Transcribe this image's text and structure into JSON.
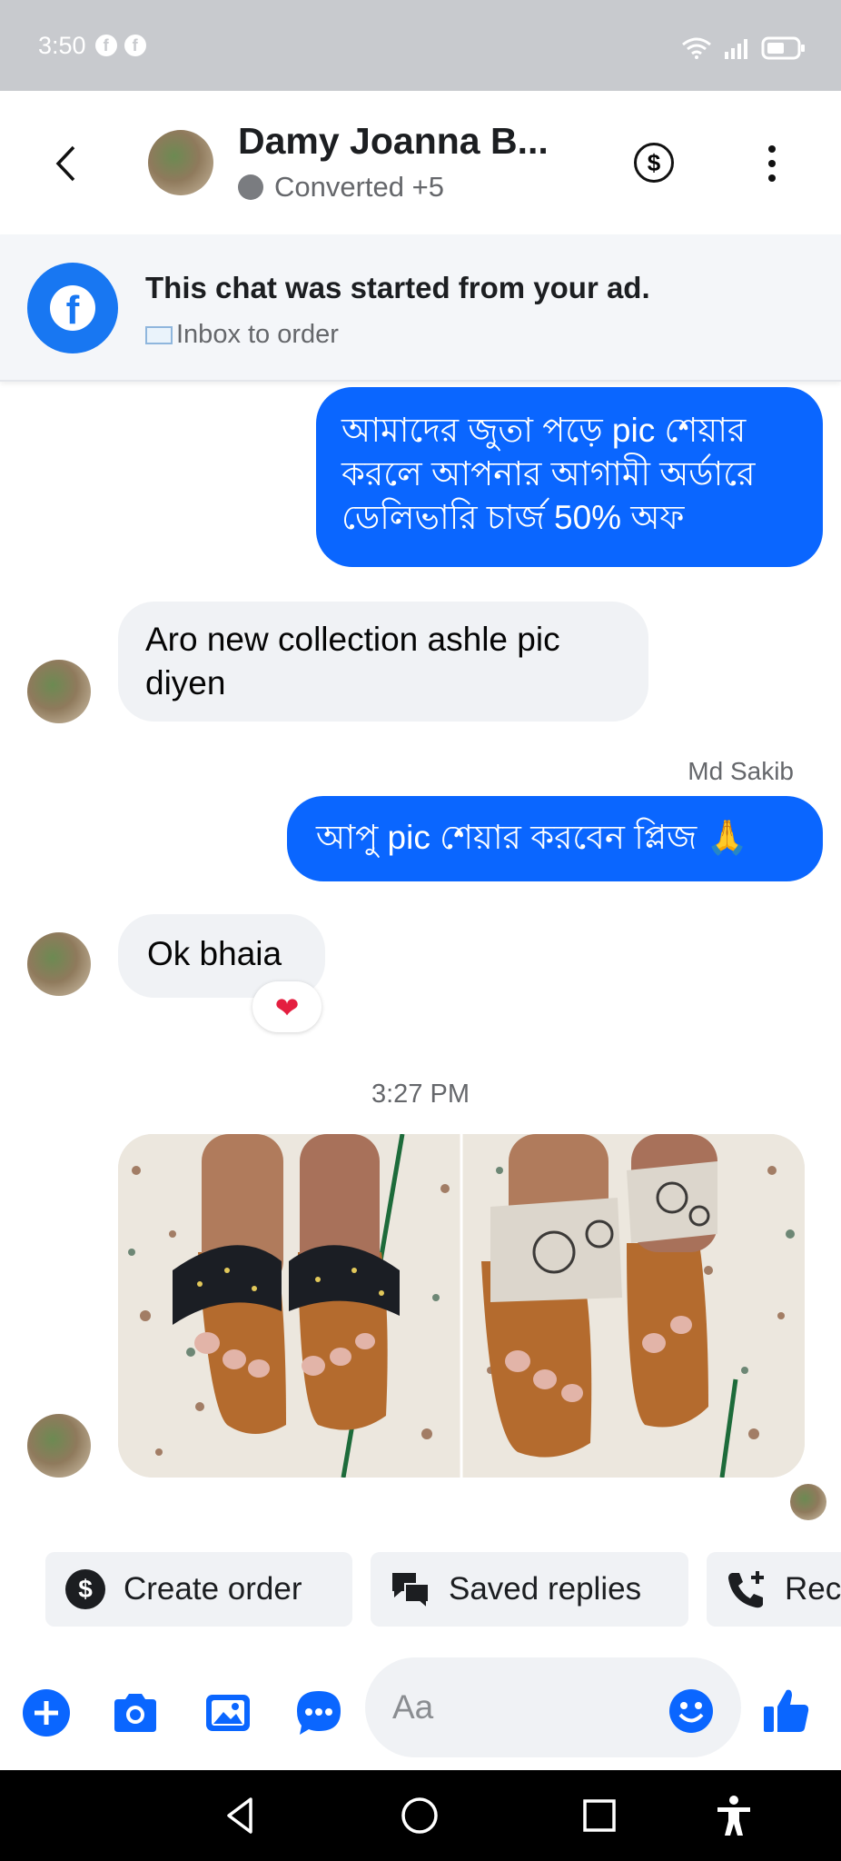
{
  "status_bar": {
    "time": "3:50",
    "notif_icons": [
      "f",
      "f"
    ]
  },
  "header": {
    "contact_name": "Damy Joanna B...",
    "contact_status": "Converted +5"
  },
  "ad_banner": {
    "title": "This chat was started from your ad.",
    "subtitle": "Inbox to order"
  },
  "messages": [
    {
      "direction": "outgoing",
      "text": "আমাদের জুতা পড়ে pic শেয়ার করলে আপনার আগামী অর্ডারে ডেলিভারি চার্জ 50% অফ"
    },
    {
      "direction": "incoming",
      "text": "Aro new collection ashle pic diyen"
    },
    {
      "direction": "outgoing",
      "sender": "Md Sakib",
      "text": "আপু pic শেয়ার করবেন প্লিজ 🙏"
    },
    {
      "direction": "incoming",
      "text": "Ok bhaia",
      "reaction": "❤"
    }
  ],
  "timestamp": "3:27 PM",
  "quick_actions": [
    {
      "label": "Create order",
      "icon": "dollar-icon"
    },
    {
      "label": "Saved replies",
      "icon": "chat-bubbles-icon"
    },
    {
      "label": "Rec",
      "icon": "add-call-icon"
    }
  ],
  "composer": {
    "placeholder": "Aa"
  },
  "colors": {
    "messenger_blue": "#0a66ff",
    "facebook_blue": "#1877f2",
    "bubble_gray": "#f0f2f5"
  }
}
